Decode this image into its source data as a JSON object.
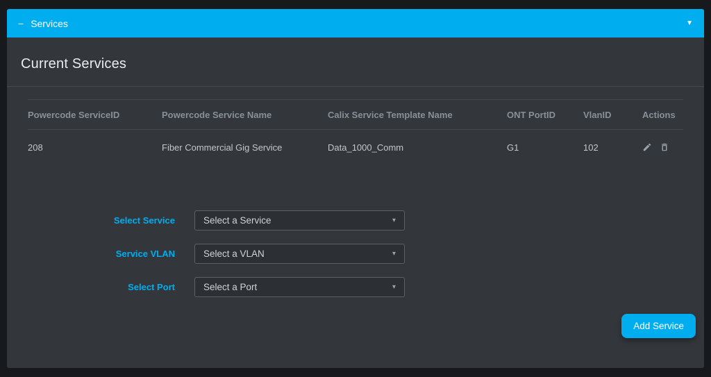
{
  "panel": {
    "header": {
      "collapse_icon": "−",
      "title": "Services",
      "caret_icon": "▼"
    },
    "section_title": "Current Services"
  },
  "table": {
    "headers": [
      "Powercode ServiceID",
      "Powercode Service Name",
      "Calix Service Template Name",
      "ONT PortID",
      "VlanID",
      "Actions"
    ],
    "rows": [
      {
        "powercode_service_id": "208",
        "powercode_service_name": "Fiber Commercial Gig Service",
        "calix_service_template_name": "Data_1000_Comm",
        "ont_port_id": "G1",
        "vlan_id": "102"
      }
    ]
  },
  "form": {
    "fields": [
      {
        "label": "Select Service",
        "value": "Select a Service",
        "caret": "▾"
      },
      {
        "label": "Service VLAN",
        "value": "Select a VLAN",
        "caret": "▾"
      },
      {
        "label": "Select Port",
        "value": "Select a Port",
        "caret": "▾"
      }
    ],
    "add_button_label": "Add Service"
  },
  "icons": {
    "edit": "pencil-icon",
    "delete": "trash-icon"
  },
  "colors": {
    "accent": "#00aeef",
    "panel_bg": "#33373c",
    "outer_bg": "#17191c",
    "divider": "#45494f",
    "header_text": "#878f97",
    "body_text": "#c2c7cc"
  }
}
